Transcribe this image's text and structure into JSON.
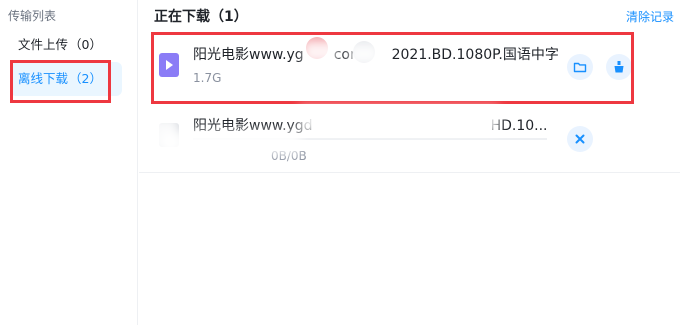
{
  "sidebar": {
    "title": "传输列表",
    "items": [
      {
        "label": "文件上传",
        "count": "（0）"
      },
      {
        "label": "离线下载",
        "count": "（2）"
      }
    ]
  },
  "header": {
    "title": "正在下载（1）",
    "clear_label": "清除记录"
  },
  "downloads": [
    {
      "name_prefix": "阳光电影www.yg",
      "name_mid": "com",
      "name_suffix": "2021.BD.1080P.国语中字",
      "meta": "1.7G",
      "icon": "video-file-icon",
      "actions": [
        "folder-icon",
        "clean-icon"
      ]
    },
    {
      "name_prefix": "阳光电影www.ygd",
      "name_suffix": "HD.10...",
      "meta": "0B/0B",
      "progress": 0,
      "icon": "file-icon",
      "actions": [
        "close-icon"
      ]
    }
  ],
  "colors": {
    "accent": "#1890ff",
    "highlight_box": "#ee3840",
    "video_icon": "#8b7cf6"
  }
}
